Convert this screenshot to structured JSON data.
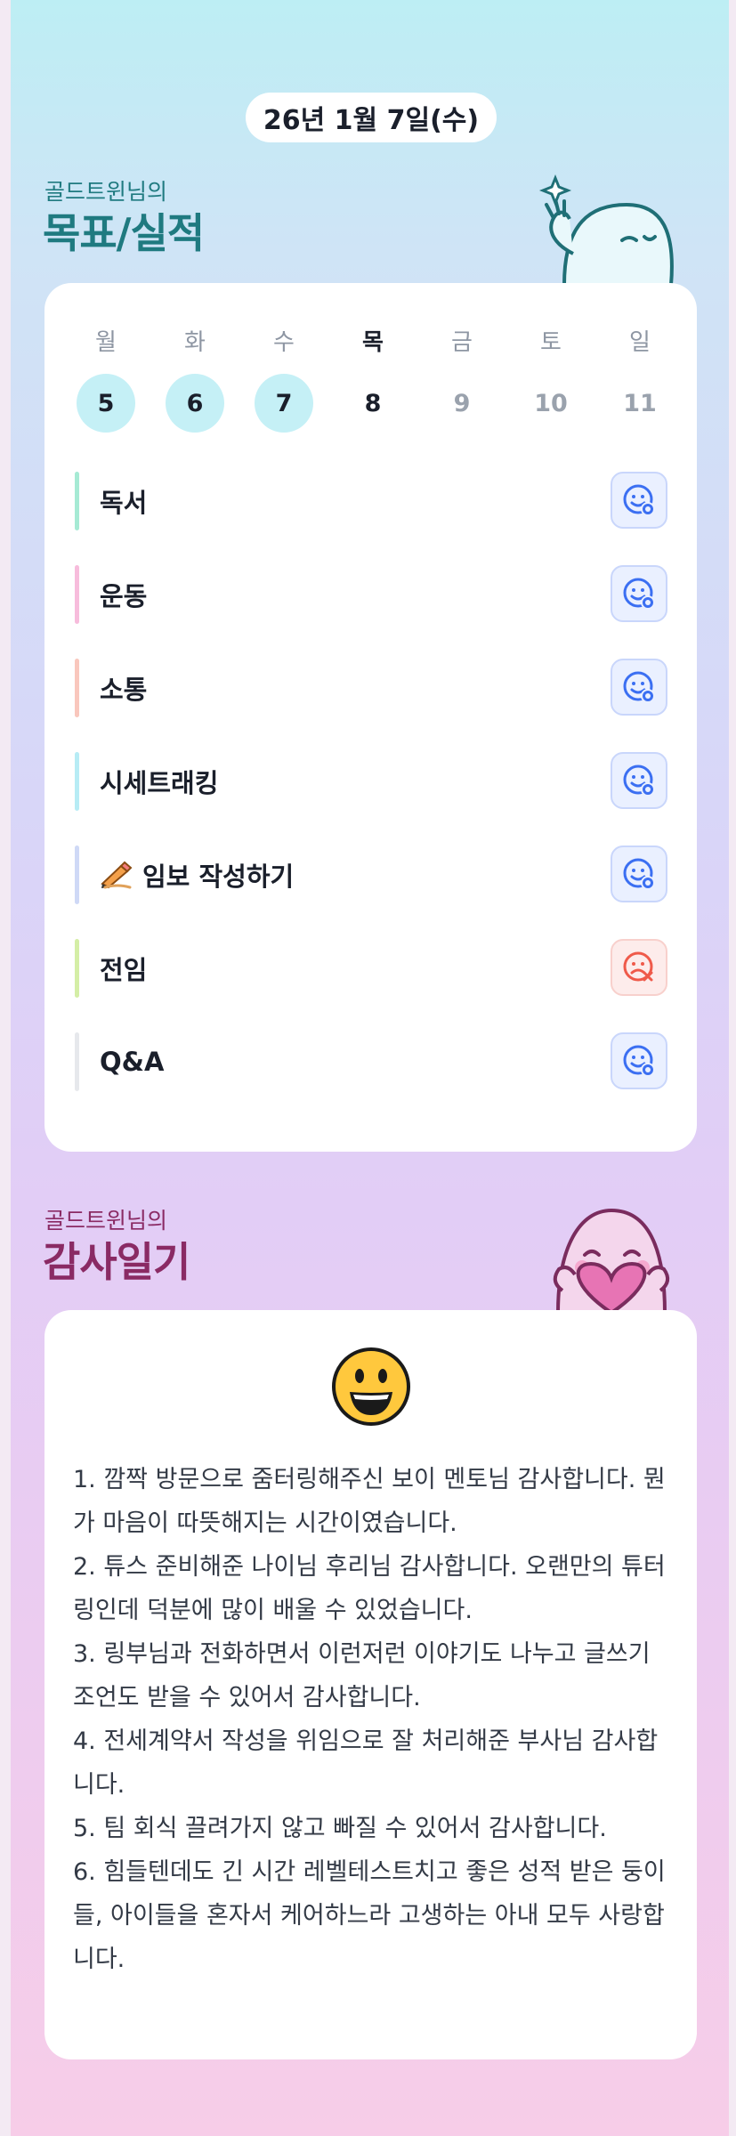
{
  "date": "26년 1월 7일(수)",
  "goals_section": {
    "owner": "골드트윈님의",
    "title": "목표/실적"
  },
  "week": [
    {
      "weekday": "월",
      "day": "5",
      "state": "done"
    },
    {
      "weekday": "화",
      "day": "6",
      "state": "done"
    },
    {
      "weekday": "수",
      "day": "7",
      "state": "done"
    },
    {
      "weekday": "목",
      "day": "8",
      "state": "today"
    },
    {
      "weekday": "금",
      "day": "9",
      "state": "future"
    },
    {
      "weekday": "토",
      "day": "10",
      "state": "future"
    },
    {
      "weekday": "일",
      "day": "11",
      "state": "future"
    }
  ],
  "goals": [
    {
      "label": "독서",
      "bar_color": "#a6ead4",
      "status": "smile-check-icon"
    },
    {
      "label": "운동",
      "bar_color": "#f7bcdc",
      "status": "smile-check-icon"
    },
    {
      "label": "소통",
      "bar_color": "#f9c7bd",
      "status": "smile-check-icon"
    },
    {
      "label": "시세트래킹",
      "bar_color": "#b7ecf5",
      "status": "smile-check-icon"
    },
    {
      "label": "임보 작성하기",
      "icon": "writing-hand-icon",
      "bar_color": "#cfd9f6",
      "status": "smile-check-icon"
    },
    {
      "label": "전임",
      "bar_color": "#d4eea6",
      "status": "sad-x-icon"
    },
    {
      "label": "Q&A",
      "bar_color": "#e6e8ec",
      "status": "smile-check-icon"
    }
  ],
  "diary_section": {
    "owner": "골드트윈님의",
    "title": "감사일기"
  },
  "diary": {
    "mood_icon": "grinning-face-icon",
    "entries": [
      "1. 깜짝 방문으로 줌터링해주신 보이 멘토님 감사합니다. 뭔가 마음이 따뜻해지는 시간이였습니다.",
      "2. 튜스 준비해준 나이님 후리님 감사합니다. 오랜만의 튜터링인데 덕분에 많이 배울 수 있었습니다.",
      "3. 링부님과 전화하면서 이런저런 이야기도 나누고 글쓰기 조언도 받을 수 있어서 감사합니다.",
      "4. 전세계약서 작성을 위임으로 잘 처리해준 부사님 감사합니다.",
      "5. 팀 회식 끌려가지 않고 빠질 수 있어서 감사합니다.",
      "6. 힘들텐데도 긴 시간 레벨테스트치고 좋은 성적 받은 둥이들, 아이들을 혼자서 케어하느라 고생하는 아내 모두 사랑합니다."
    ]
  },
  "colors": {
    "accent_teal": "#1f7a80",
    "accent_plum": "#8a2a64",
    "done_day": "#c5f0f6"
  }
}
